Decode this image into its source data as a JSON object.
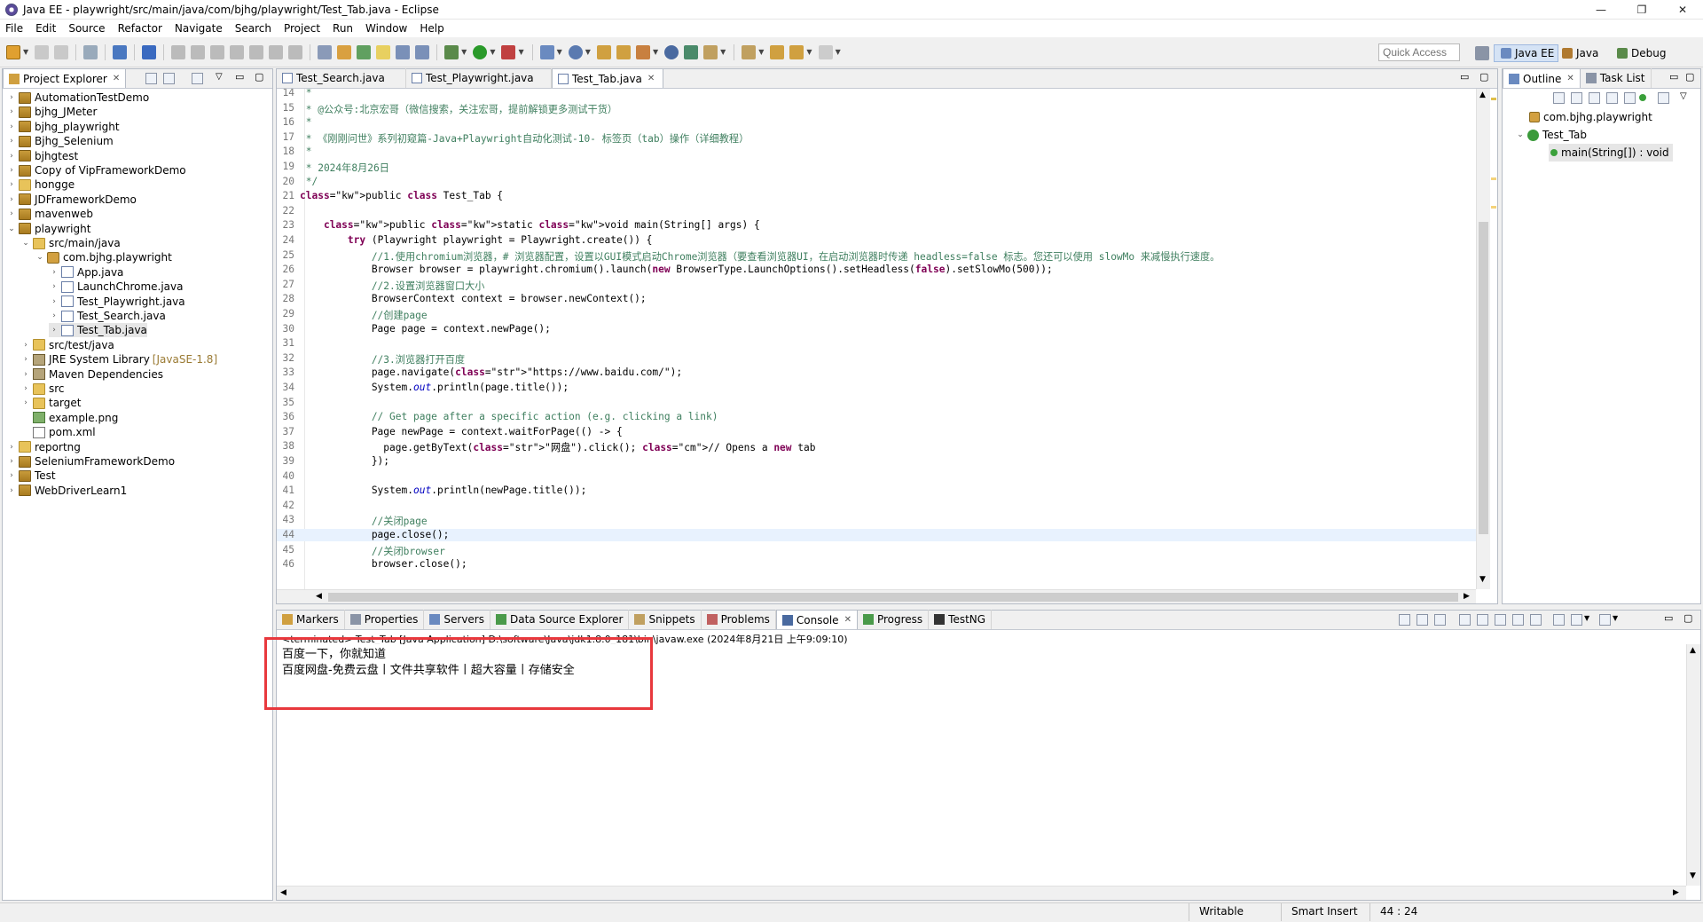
{
  "window": {
    "title": "Java EE - playwright/src/main/java/com/bjhg/playwright/Test_Tab.java - Eclipse",
    "minimize": "—",
    "maximize": "❐",
    "close": "✕"
  },
  "menubar": [
    "File",
    "Edit",
    "Source",
    "Refactor",
    "Navigate",
    "Search",
    "Project",
    "Run",
    "Window",
    "Help"
  ],
  "toolbar": {
    "quick_access_placeholder": "Quick Access",
    "perspectives": [
      "Java EE",
      "Java",
      "Debug"
    ],
    "active_perspective": "Java EE"
  },
  "project_explorer": {
    "tab_label": "Project Explorer",
    "items": [
      {
        "label": "AutomationTestDemo",
        "icon": "project-icon",
        "twisty": "›"
      },
      {
        "label": "bjhg_JMeter",
        "icon": "project-icon",
        "twisty": "›"
      },
      {
        "label": "bjhg_playwright",
        "icon": "project-icon",
        "twisty": "›"
      },
      {
        "label": "Bjhg_Selenium",
        "icon": "project-icon",
        "twisty": "›"
      },
      {
        "label": "bjhgtest",
        "icon": "project-icon",
        "twisty": "›"
      },
      {
        "label": "Copy of VipFrameworkDemo",
        "icon": "project-icon",
        "twisty": "›"
      },
      {
        "label": "hongge",
        "icon": "folder-icon",
        "twisty": "›"
      },
      {
        "label": "JDFrameworkDemo",
        "icon": "project-icon",
        "twisty": "›"
      },
      {
        "label": "mavenweb",
        "icon": "project-icon",
        "twisty": "›"
      },
      {
        "label": "playwright",
        "icon": "project-icon",
        "twisty": "⌄"
      },
      {
        "label": "src/main/java",
        "icon": "source-folder-icon",
        "twisty": "⌄"
      },
      {
        "label": "com.bjhg.playwright",
        "icon": "package-icon",
        "twisty": "⌄"
      },
      {
        "label": "App.java",
        "icon": "java-file-icon",
        "twisty": "›"
      },
      {
        "label": "LaunchChrome.java",
        "icon": "java-file-icon",
        "twisty": "›"
      },
      {
        "label": "Test_Playwright.java",
        "icon": "java-file-icon",
        "twisty": "›"
      },
      {
        "label": "Test_Search.java",
        "icon": "java-file-icon",
        "twisty": "›"
      },
      {
        "label": "Test_Tab.java",
        "icon": "java-file-icon",
        "twisty": "›"
      },
      {
        "label": "src/test/java",
        "icon": "source-folder-icon",
        "twisty": "›"
      },
      {
        "label": "JRE System Library",
        "decoration": "[JavaSE-1.8]",
        "icon": "library-icon",
        "twisty": "›"
      },
      {
        "label": "Maven Dependencies",
        "icon": "library-icon",
        "twisty": "›"
      },
      {
        "label": "src",
        "icon": "folder-icon",
        "twisty": "›"
      },
      {
        "label": "target",
        "icon": "folder-icon",
        "twisty": "›"
      },
      {
        "label": "example.png",
        "icon": "image-file-icon",
        "twisty": ""
      },
      {
        "label": "pom.xml",
        "icon": "xml-file-icon",
        "twisty": ""
      },
      {
        "label": "reportng",
        "icon": "folder-icon",
        "twisty": "›"
      },
      {
        "label": "SeleniumFrameworkDemo",
        "icon": "project-icon",
        "twisty": "›"
      },
      {
        "label": "Test",
        "icon": "project-icon",
        "twisty": "›"
      },
      {
        "label": "WebDriverLearn1",
        "icon": "project-icon",
        "twisty": "›"
      }
    ],
    "selected": "Test_Tab.java"
  },
  "editor": {
    "tabs": [
      "Test_Search.java",
      "Test_Playwright.java",
      "Test_Tab.java"
    ],
    "active_tab": "Test_Tab.java",
    "lines": [
      {
        "n": "14",
        "text": " *"
      },
      {
        "n": "15",
        "text": " * @公众号:北京宏哥（微信搜索，关注宏哥，提前解锁更多测试干货）"
      },
      {
        "n": "16",
        "text": " *"
      },
      {
        "n": "17",
        "text": " * 《刚刚问世》系列初窥篇-Java+Playwright自动化测试-10- 标签页（tab）操作（详细教程）"
      },
      {
        "n": "18",
        "text": " *"
      },
      {
        "n": "19",
        "text": " * 2024年8月26日"
      },
      {
        "n": "20",
        "text": " */"
      },
      {
        "n": "21",
        "text": "public class Test_Tab {"
      },
      {
        "n": "22",
        "text": ""
      },
      {
        "n": "23",
        "text": "    public static void main(String[] args) {"
      },
      {
        "n": "24",
        "text": "        try (Playwright playwright = Playwright.create()) {"
      },
      {
        "n": "25",
        "text": "            //1.使用chromium浏览器，# 浏览器配置，设置以GUI模式启动Chrome浏览器（要查看浏览器UI，在启动浏览器时传递 headless=false 标志。您还可以使用 slowMo 来减慢执行速度。"
      },
      {
        "n": "26",
        "text": "            Browser browser = playwright.chromium().launch(new BrowserType.LaunchOptions().setHeadless(false).setSlowMo(500));"
      },
      {
        "n": "27",
        "text": "            //2.设置浏览器窗口大小"
      },
      {
        "n": "28",
        "text": "            BrowserContext context = browser.newContext();"
      },
      {
        "n": "29",
        "text": "            //创建page"
      },
      {
        "n": "30",
        "text": "            Page page = context.newPage();"
      },
      {
        "n": "31",
        "text": ""
      },
      {
        "n": "32",
        "text": "            //3.浏览器打开百度"
      },
      {
        "n": "33",
        "text": "            page.navigate(\"https://www.baidu.com/\");"
      },
      {
        "n": "34",
        "text": "            System.out.println(page.title());"
      },
      {
        "n": "35",
        "text": ""
      },
      {
        "n": "36",
        "text": "            // Get page after a specific action (e.g. clicking a link)"
      },
      {
        "n": "37",
        "text": "            Page newPage = context.waitForPage(() -> {"
      },
      {
        "n": "38",
        "text": "              page.getByText(\"网盘\").click(); // Opens a new tab"
      },
      {
        "n": "39",
        "text": "            });"
      },
      {
        "n": "40",
        "text": ""
      },
      {
        "n": "41",
        "text": "            System.out.println(newPage.title());"
      },
      {
        "n": "42",
        "text": ""
      },
      {
        "n": "43",
        "text": "            //关闭page"
      },
      {
        "n": "44",
        "text": "            page.close();"
      },
      {
        "n": "45",
        "text": "            //关闭browser"
      },
      {
        "n": "46",
        "text": "            browser.close();"
      }
    ],
    "current_line": "44"
  },
  "outline": {
    "tabs": [
      "Outline",
      "Task List"
    ],
    "items": [
      "com.bjhg.playwright",
      "Test_Tab",
      "main(String[]) : void"
    ]
  },
  "bottom_panel": {
    "tabs": [
      "Markers",
      "Properties",
      "Servers",
      "Data Source Explorer",
      "Snippets",
      "Problems",
      "Console",
      "Progress",
      "TestNG"
    ],
    "active_tab": "Console",
    "console_header": "<terminated> Test_Tab [Java Application] D:\\software\\Java\\jdk1.8.0_181\\bin\\javaw.exe (2024年8月21日 上午9:09:10)",
    "output_lines": [
      "百度一下，你就知道",
      "百度网盘-免费云盘丨文件共享软件丨超大容量丨存储安全"
    ],
    "highlight_color": "#e8383d"
  },
  "statusbar": {
    "writable": "Writable",
    "insert_mode": "Smart Insert",
    "position": "44 : 24"
  }
}
